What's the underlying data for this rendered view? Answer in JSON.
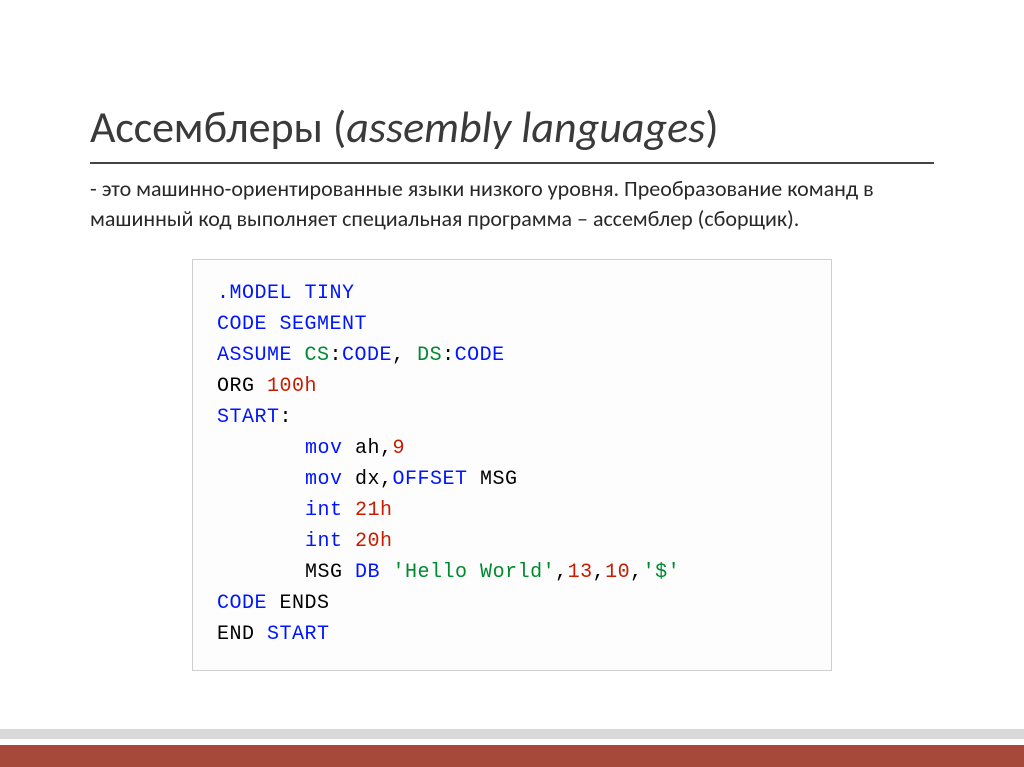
{
  "title": {
    "mainWord": "Ассемблеры",
    "openParen": " (",
    "italic": "assembly languages",
    "closeParen": ")"
  },
  "description": "- это машинно-ориентированные языки низкого уровня. Преобразование команд в машинный код выполняет специальная программа – ассемблер (сборщик).",
  "code": {
    "l01_a": ".MODEL TINY",
    "l02_a": "CODE SEGMENT",
    "l03_a": "ASSUME",
    "l03_b": " CS",
    "l03_c": ":",
    "l03_d": "CODE",
    "l03_e": ",",
    "l03_f": " DS",
    "l03_g": ":",
    "l03_h": "CODE",
    "l04_a": "ORG ",
    "l04_b": "100h",
    "l05_a": "START",
    "l05_b": ":",
    "l06_a": "mov",
    "l06_b": " ah,",
    "l06_c": "9",
    "l07_a": "mov",
    "l07_b": " dx,",
    "l07_c": "OFFSET",
    "l07_d": " MSG",
    "l08_a": "int",
    "l08_b": " ",
    "l08_c": "21h",
    "l09_a": "int",
    "l09_b": " ",
    "l09_c": "20h",
    "l10_a": "MSG ",
    "l10_b": "DB",
    "l10_c": " ",
    "l10_d": "'Hello World'",
    "l10_e": ",",
    "l10_f": "13",
    "l10_g": ",",
    "l10_h": "10",
    "l10_i": ",",
    "l10_j": "'$'",
    "l11_a": "CODE",
    "l11_b": " ENDS",
    "l12_a": "END ",
    "l12_b": "START"
  }
}
